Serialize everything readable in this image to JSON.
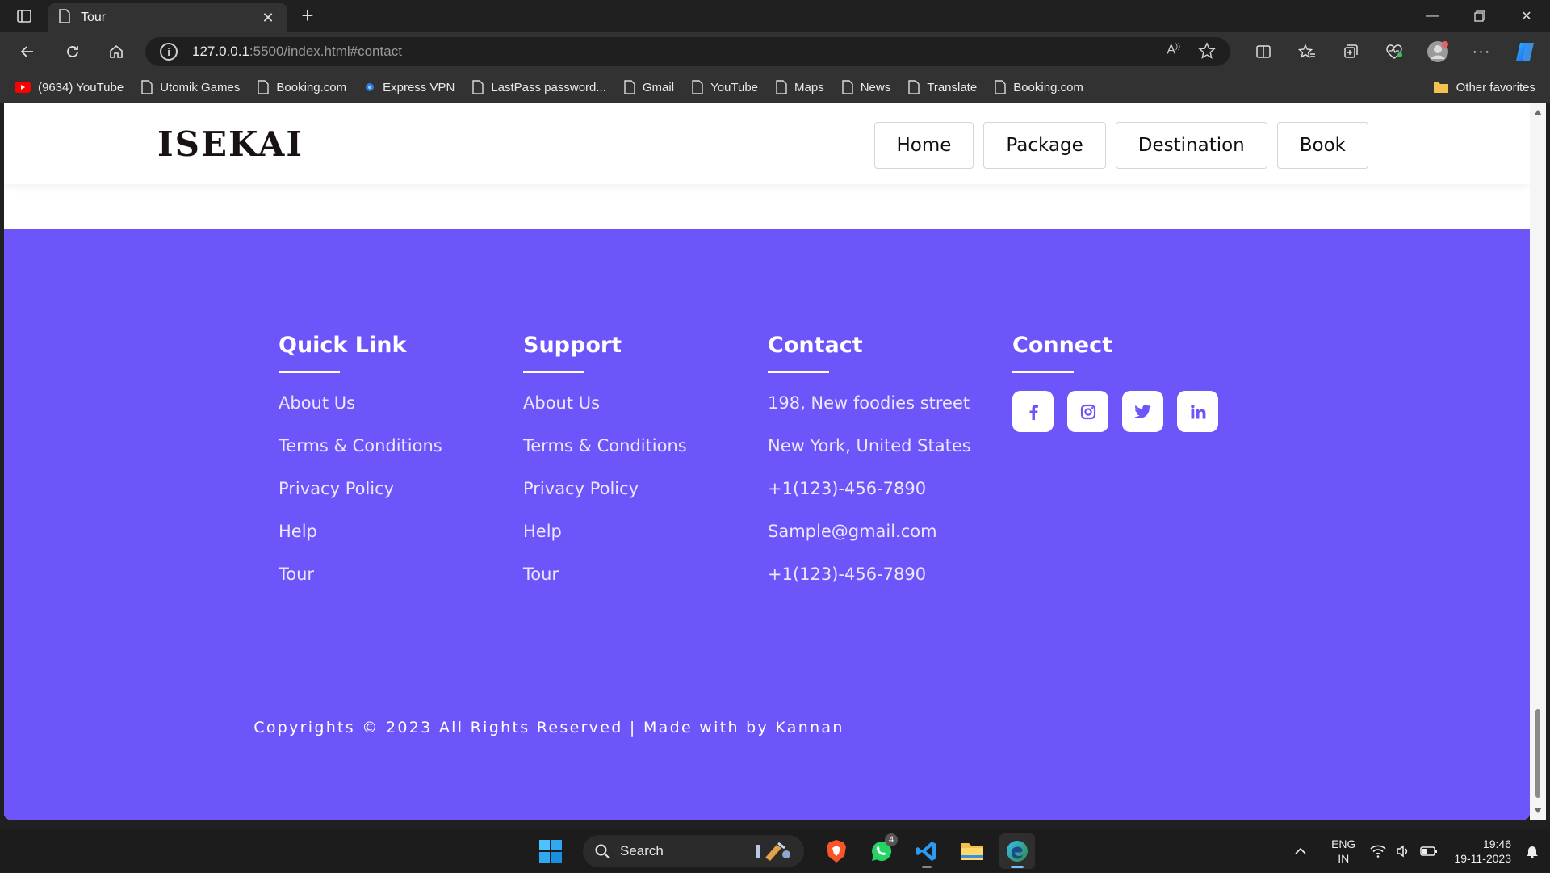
{
  "browser": {
    "tab_title": "Tour",
    "url_host": "127.0.0.1",
    "url_rest": ":5500/index.html#contact",
    "bookmarks": [
      {
        "label": "(9634) YouTube",
        "icon": "youtube-icon"
      },
      {
        "label": "Utomik Games",
        "icon": "page-icon"
      },
      {
        "label": "Booking.com",
        "icon": "page-icon"
      },
      {
        "label": "Express VPN",
        "icon": "vpn-icon"
      },
      {
        "label": "LastPass password...",
        "icon": "page-icon"
      },
      {
        "label": "Gmail",
        "icon": "page-icon"
      },
      {
        "label": "YouTube",
        "icon": "page-icon"
      },
      {
        "label": "Maps",
        "icon": "page-icon"
      },
      {
        "label": "News",
        "icon": "page-icon"
      },
      {
        "label": "Translate",
        "icon": "page-icon"
      },
      {
        "label": "Booking.com",
        "icon": "page-icon"
      }
    ],
    "other_favorites": "Other favorites"
  },
  "site": {
    "logo": "ISEKAI",
    "nav": [
      "Home",
      "Package",
      "Destination",
      "Book"
    ]
  },
  "footer": {
    "quick_link": {
      "title": "Quick Link",
      "links": [
        "About Us",
        "Terms & Conditions",
        "Privacy Policy",
        "Help",
        "Tour"
      ]
    },
    "support": {
      "title": "Support",
      "links": [
        "About Us",
        "Terms & Conditions",
        "Privacy Policy",
        "Help",
        "Tour"
      ]
    },
    "contact": {
      "title": "Contact",
      "lines": [
        "198, New foodies street",
        "New York, United States",
        "+1(123)-456-7890",
        "Sample@gmail.com",
        "+1(123)-456-7890"
      ]
    },
    "connect": {
      "title": "Connect",
      "socials": [
        "facebook-icon",
        "instagram-icon",
        "twitter-icon",
        "linkedin-icon"
      ]
    },
    "copyright": "Copyrights © 2023 All Rights Reserved | Made with by Kannan"
  },
  "colors": {
    "footer_bg": "#6c56fa",
    "page_bg": "#ffffff"
  },
  "taskbar": {
    "search_label": "Search",
    "whatsapp_badge": "4",
    "lang_line1": "ENG",
    "lang_line2": "IN",
    "time": "19:46",
    "date": "19-11-2023"
  }
}
